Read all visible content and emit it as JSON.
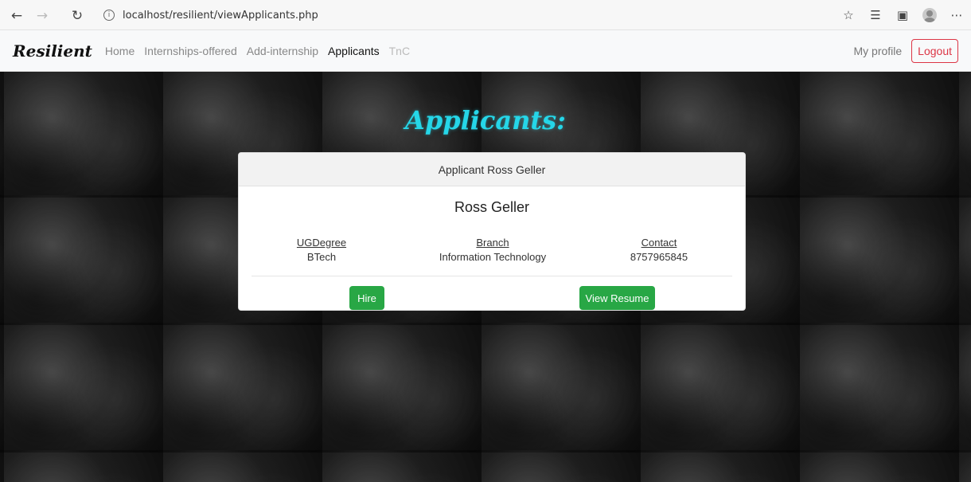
{
  "browser": {
    "url": "localhost/resilient/viewApplicants.php"
  },
  "navbar": {
    "brand": "Resilient",
    "links": [
      "Home",
      "Internships-offered",
      "Add-internship",
      "Applicants",
      "TnC"
    ],
    "my_profile": "My profile",
    "logout": "Logout"
  },
  "page": {
    "title": "Applicants:"
  },
  "card": {
    "header": "Applicant Ross Geller",
    "name": "Ross Geller",
    "fields": [
      {
        "label": "UGDegree",
        "value": "BTech"
      },
      {
        "label": "Branch",
        "value": "Information Technology"
      },
      {
        "label": "Contact",
        "value": "8757965845"
      }
    ],
    "hire_label": "Hire",
    "resume_label": "View Resume"
  },
  "colors": {
    "title_accent": "#25d6e8",
    "button_green": "#28a745",
    "logout_red": "#dc3545"
  }
}
